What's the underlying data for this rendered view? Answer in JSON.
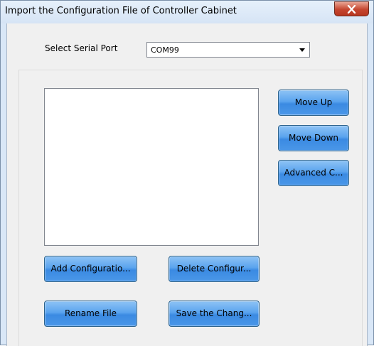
{
  "window": {
    "title": "Import the Configuration File of Controller Cabinet"
  },
  "serial_port": {
    "label": "Select Serial Port",
    "selected": "COM99"
  },
  "buttons": {
    "move_up": "Move Up",
    "move_down": "Move Down",
    "advanced": "Advanced C...",
    "add_configuration": "Add Configuratio...",
    "delete_configuration": "Delete Configur...",
    "rename_file": "Rename File",
    "save_changes": "Save the Chang..."
  },
  "config_files": [],
  "colors": {
    "button_blue": "#4a97e8",
    "close_red": "#c5462f",
    "titlebar": "#d9e7f7"
  },
  "icons": {
    "close": "close-icon",
    "dropdown": "chevron-down-icon"
  }
}
